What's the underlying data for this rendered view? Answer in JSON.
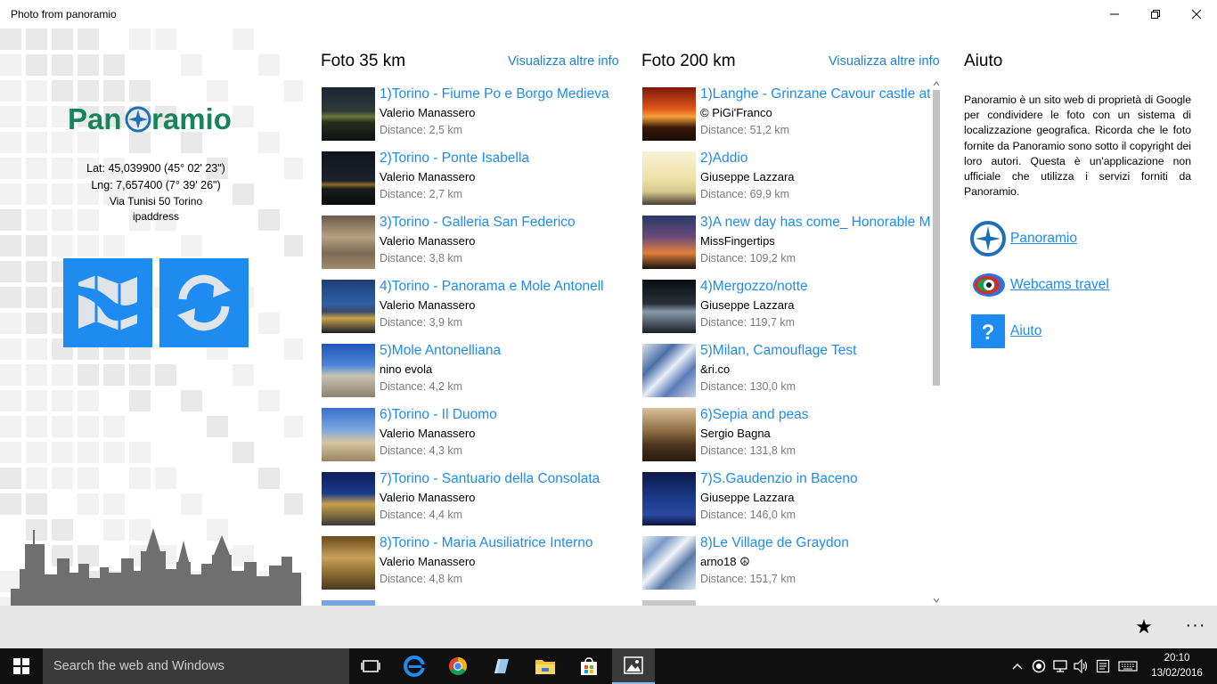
{
  "window": {
    "title": "Photo from panoramio"
  },
  "left": {
    "lat": "Lat: 45,039900 (45° 02' 23\")",
    "lng": "Lng: 7,657400 (7° 39' 26\")",
    "address": "Via Tunisi 50 Torino",
    "ip": "ipaddress",
    "logo_text": "Panoramio"
  },
  "col35": {
    "heading": "Foto 35 km",
    "more_link": "Visualizza altre info",
    "items": [
      {
        "title": "1)Torino - Fiume Po e Borgo Medieva",
        "author": "Valerio Manassero",
        "distance": "Distance: 2,5 km",
        "thumb": "night-river"
      },
      {
        "title": "2)Torino - Ponte Isabella",
        "author": "Valerio Manassero",
        "distance": "Distance: 2,7 km",
        "thumb": "night-bridge"
      },
      {
        "title": "3)Torino - Galleria San Federico",
        "author": "Valerio Manassero",
        "distance": "Distance: 3,8 km",
        "thumb": "gallery"
      },
      {
        "title": "4)Torino - Panorama e Mole Antonell",
        "author": "Valerio Manassero",
        "distance": "Distance: 3,9 km",
        "thumb": "panorama"
      },
      {
        "title": "5)Mole Antonelliana",
        "author": "nino evola",
        "distance": "Distance: 4,2 km",
        "thumb": "dome"
      },
      {
        "title": "6)Torino - Il Duomo",
        "author": "Valerio Manassero",
        "distance": "Distance: 4,3 km",
        "thumb": "duomo"
      },
      {
        "title": "7)Torino - Santuario della Consolata",
        "author": "Valerio Manassero",
        "distance": "Distance: 4,4 km",
        "thumb": "santuario"
      },
      {
        "title": "8)Torino - Maria Ausiliatrice Interno",
        "author": "Valerio Manassero",
        "distance": "Distance: 4,8 km",
        "thumb": "interior"
      }
    ]
  },
  "col200": {
    "heading": "Foto 200 km",
    "more_link": "Visualizza altre info",
    "items": [
      {
        "title": "1)Langhe - Grinzane Cavour castle at",
        "author": "© PiGi'Franco",
        "distance": "Distance: 51,2 km",
        "thumb": "sunset-castle"
      },
      {
        "title": "2)Addio",
        "author": "Giuseppe Lazzara",
        "distance": "Distance: 69,9 km",
        "thumb": "addio"
      },
      {
        "title": "3)A new day has come_ Honorable M",
        "author": "MissFingertips",
        "distance": "Distance: 109,2 km",
        "thumb": "tree"
      },
      {
        "title": "4)Mergozzo/notte",
        "author": "Giuseppe Lazzara",
        "distance": "Distance: 119,7 km",
        "thumb": "harbor"
      },
      {
        "title": "5)Milan, Camouflage Test",
        "author": "&ri.co",
        "distance": "Distance: 130,0 km",
        "thumb": "camouflage"
      },
      {
        "title": "6)Sepia and peas",
        "author": "Sergio Bagna",
        "distance": "Distance: 131,8 km",
        "thumb": "sepia"
      },
      {
        "title": "7)S.Gaudenzio in Baceno",
        "author": "Giuseppe Lazzara",
        "distance": "Distance: 146,0 km",
        "thumb": "blue-tower"
      },
      {
        "title": "8)Le Village de Graydon",
        "author": "arno18  ☮",
        "distance": "Distance: 151,7 km",
        "thumb": "snow"
      }
    ]
  },
  "help": {
    "heading": "Aiuto",
    "text": "Panoramio è un sito web di proprietà di Google per condividere le foto con un sistema di localizzazione geografica. Ricorda che le foto fornite da Panoramio sono sotto il copyright dei loro autori. Questa è un'applicazione non ufficiale che utilizza i servizi forniti da Panoramio.",
    "links": [
      {
        "label": "Panoramio",
        "icon": "panoramio-compass-icon"
      },
      {
        "label": "Webcams travel",
        "icon": "webcams-travel-icon"
      },
      {
        "label": "Aiuto",
        "icon": "question-icon"
      }
    ]
  },
  "taskbar": {
    "search_placeholder": "Search the web and Windows",
    "time": "20:10",
    "date": "13/02/2016"
  },
  "colors": {
    "accent": "#1e8bf0",
    "link": "#1e7fd6",
    "taskbar": "#101010"
  }
}
